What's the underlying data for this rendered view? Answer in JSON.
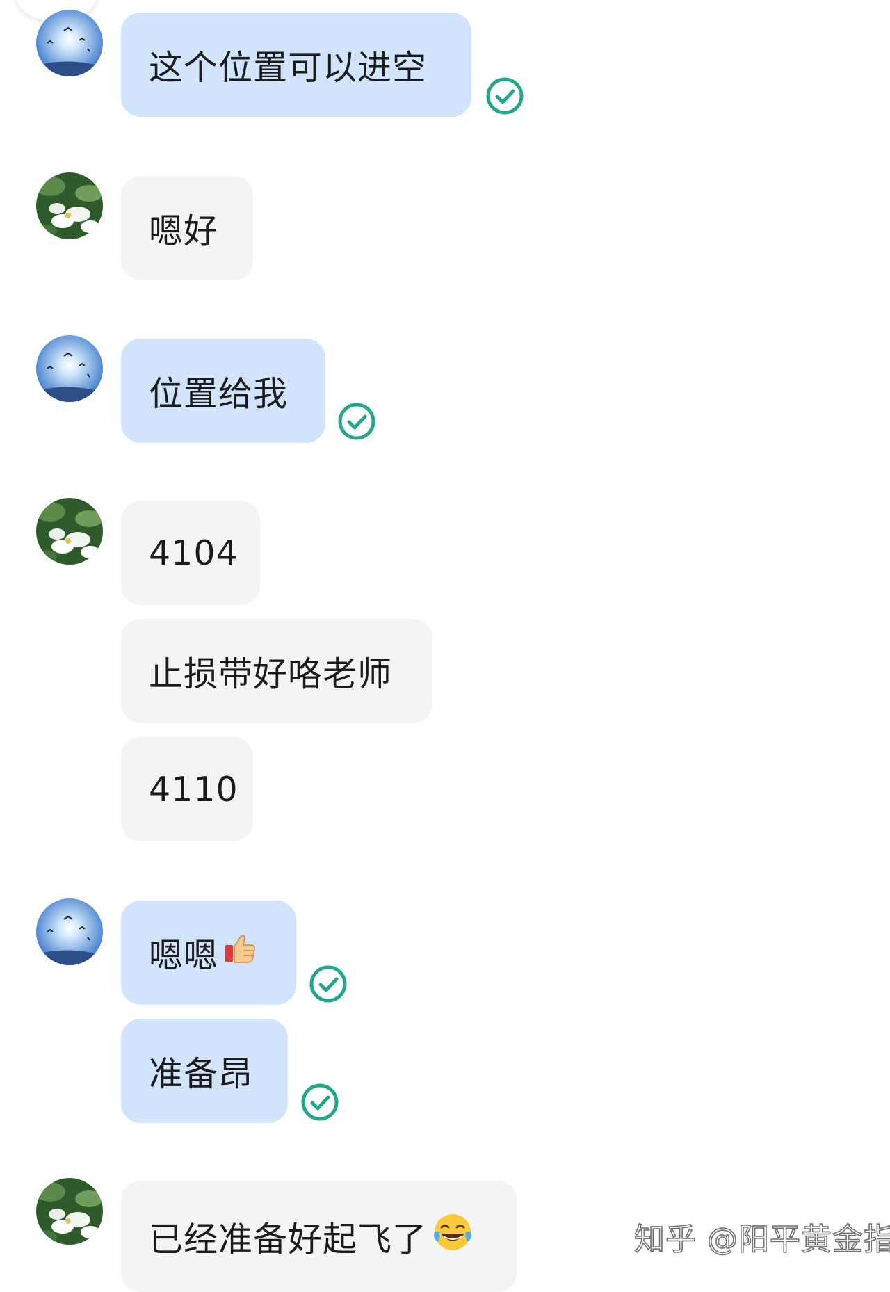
{
  "messages": [
    {
      "sender": "me",
      "text": "这个位置可以进空",
      "status": "read"
    },
    {
      "sender": "them",
      "text": "嗯好"
    },
    {
      "sender": "me",
      "text": "位置给我",
      "status": "read"
    },
    {
      "sender": "them",
      "text": "4104"
    },
    {
      "sender": "them",
      "text": "止损带好咯老师"
    },
    {
      "sender": "them",
      "text": "4110"
    },
    {
      "sender": "me",
      "text": "嗯嗯",
      "emoji": "thumbs-up",
      "status": "read"
    },
    {
      "sender": "me",
      "text": "准备昂",
      "status": "read"
    },
    {
      "sender": "them",
      "text": "已经准备好起飞了",
      "emoji": "tears-of-joy"
    }
  ],
  "watermark": "知乎 @阳平黄金指南",
  "colors": {
    "my_bubble": "#d2e3fc",
    "their_bubble": "#f3f4f6",
    "read_check": "#22a78c",
    "text": "#1b1b1b"
  }
}
